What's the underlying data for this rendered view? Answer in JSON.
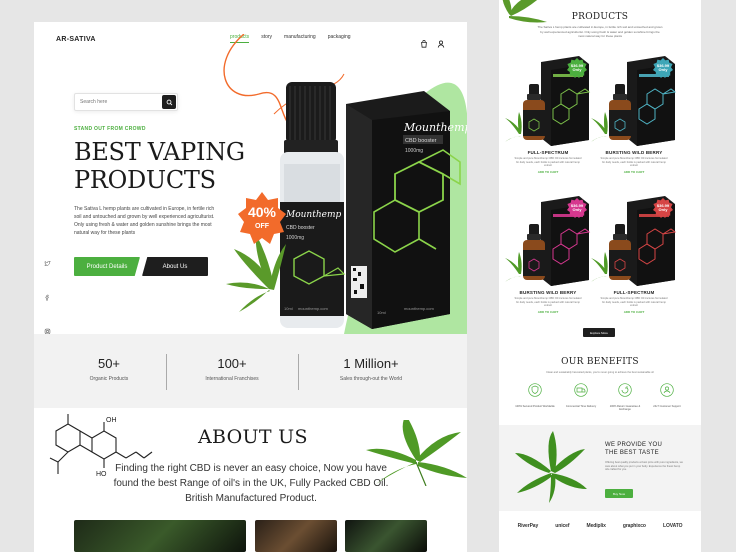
{
  "header": {
    "brand": "AR-SATIVA",
    "nav": [
      "products",
      "story",
      "manufacturing",
      "packaging"
    ],
    "active_nav": "products",
    "icons": [
      "bag-icon",
      "user-icon"
    ]
  },
  "hero": {
    "search_placeholder": "Search here",
    "eyebrow": "STAND OUT FROM CROWD",
    "title_line1": "BEST VAPING",
    "title_line2": "PRODUCTS",
    "description": "The Sativa L hemp plants are cultivated in Europe, in fertile rich soil and untouched and grown by well experienced agriculturist. Only using fresh & water and golden sunshine brings the most natural way for these plants",
    "primary_button": "Product Details",
    "secondary_button": "About Us",
    "discount_pct": "40%",
    "discount_word": "OFF",
    "bottle_brand": "Mounthemp",
    "bottle_line1": "CBD booster",
    "bottle_line2": "1000mg",
    "bottle_url": "mounthemp.com",
    "bottle_volume": "10ml",
    "box_brand": "Mounthemp",
    "box_line1": "CBD booster",
    "box_line2": "1000mg",
    "box_url": "mounthemp.com",
    "box_volume": "10ml"
  },
  "social": [
    "twitter-icon",
    "facebook-icon",
    "instagram-icon"
  ],
  "stats": [
    {
      "value": "50+",
      "label": "Organic Products"
    },
    {
      "value": "100+",
      "label": "International Franchises"
    },
    {
      "value": "1 Million+",
      "label": "Sales through-out the World"
    }
  ],
  "about": {
    "title": "ABOUT US",
    "text": "Finding the right CBD is never an easy choice, Now you have found the best Range of  oil's in the UK, Fully Packed CBD Oil. British Manufactured Product.",
    "molecule_labels": [
      "OH",
      "HO"
    ]
  },
  "products": {
    "title": "PRODUCTS",
    "subtitle": "The Sativa L hemp plants are cultivated in Europe, in fertile rich soil and untouched and grown by well experienced agriculturist. Only using fresh & water and golden sunshine brings the most natural way for these plants",
    "items": [
      {
        "name": "FULL-SPECTRUM",
        "price": "$36.99",
        "price_sub": "Only",
        "cta": "ADD TO CART",
        "desc": "Simple and pure Mounthemp CBD Oil tinctures formulated for daily needs, each bottle is packed with natural hemp extract",
        "accent": "#7cc04a",
        "tag_color": "#4caf3f"
      },
      {
        "name": "BURSTING WILD BERRY",
        "price": "$36.99",
        "price_sub": "Only",
        "cta": "ADD TO CART",
        "desc": "Simple and pure Mounthemp CBD Oil tinctures formulated for daily needs, each bottle is packed with natural hemp extract",
        "accent": "#4fb3c4",
        "tag_color": "#3ea6b7"
      },
      {
        "name": "BURSTING WILD BERRY",
        "price": "$36.99",
        "price_sub": "Only",
        "cta": "ADD TO CART",
        "desc": "Simple and pure Mounthemp CBD Oil tinctures formulated for daily needs, each bottle is packed with natural hemp extract",
        "accent": "#d6388f",
        "tag_color": "#d6388f"
      },
      {
        "name": "FULL-SPECTRUM",
        "price": "$36.99",
        "price_sub": "Only",
        "cta": "ADD TO CART",
        "desc": "Simple and pure Mounthemp CBD Oil tinctures formulated for daily needs, each bottle is packed with natural hemp extract",
        "accent": "#d64545",
        "tag_color": "#d64545"
      }
    ],
    "explore_button": "Explore More"
  },
  "benefits": {
    "title": "OUR BENEFITS",
    "subtitle": "Clean and sustainably harvested plants, you're never going to achieve the best sustainable oil",
    "items": [
      {
        "label": "100% Secured Product Worldwide",
        "icon": "shield-icon"
      },
      {
        "label": "Commercial Time Delivery",
        "icon": "truck-icon"
      },
      {
        "label": "100% Return Guarantee & Exchange",
        "icon": "return-icon"
      },
      {
        "label": "24x7 Customer Support",
        "icon": "support-icon"
      }
    ]
  },
  "taste": {
    "title_line1": "WE PROVIDE YOU",
    "title_line2": "THE BEST TASTE",
    "desc": "Offering best quality products at best price with pure ingredients, we care about what you put in your body. Experience the finest hemp oils crafted for you.",
    "button": "Buy Now"
  },
  "partners": [
    "RiverPay",
    "unicef",
    "Mediplix",
    "graphixco",
    "LOVATO"
  ],
  "colors": {
    "accent": "#4caf3f",
    "dark": "#1e1e1e",
    "discount": "#f26b2b",
    "background": "#e6e6e6"
  }
}
